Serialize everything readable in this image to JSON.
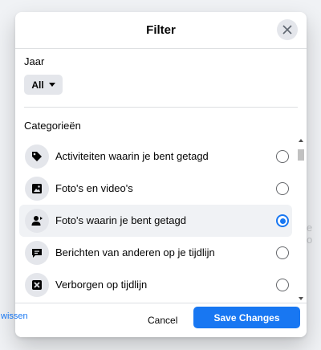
{
  "dialog": {
    "title": "Filter",
    "close_icon": "close-icon"
  },
  "year": {
    "label": "Jaar",
    "selected": "All"
  },
  "categories": {
    "label": "Categorieën",
    "items": [
      {
        "icon": "tag-icon",
        "label": "Activiteiten waarin je bent getagd",
        "selected": false
      },
      {
        "icon": "photo-icon",
        "label": "Foto's en video's",
        "selected": false
      },
      {
        "icon": "person-tag-icon",
        "label": "Foto's waarin je bent getagd",
        "selected": true
      },
      {
        "icon": "comment-icon",
        "label": "Berichten van anderen op je tijdlijn",
        "selected": false
      },
      {
        "icon": "hidden-icon",
        "label": "Verborgen op tijdlijn",
        "selected": false
      }
    ]
  },
  "footer": {
    "clear_label": "wissen",
    "cancel_label": "Cancel",
    "save_label": "Save Changes"
  },
  "background": {
    "fragment": "e o"
  },
  "colors": {
    "accent": "#1877f2",
    "icon_bg": "#e4e6eb",
    "selected_row": "#f0f2f5"
  }
}
